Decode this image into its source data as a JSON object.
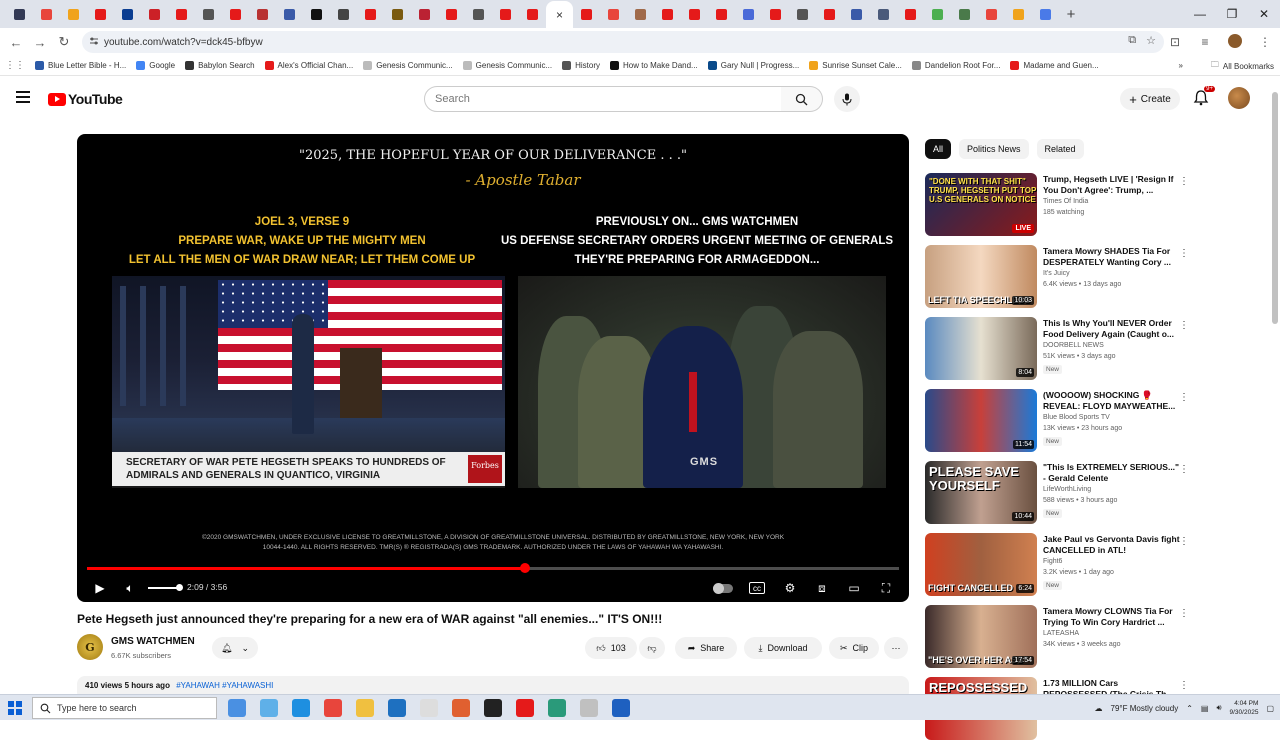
{
  "browser": {
    "tab_colors": [
      "#333a55",
      "#e8453c",
      "#f0a31c",
      "#e51a1a",
      "#0a3d91",
      "#cc2127",
      "#e51a1a",
      "#555555",
      "#e51a1a",
      "#b83232",
      "#3a5aa8",
      "#111111",
      "#444444",
      "#e51a1a",
      "#7a5a10",
      "#bb2233",
      "#e51a1a",
      "#555555",
      "#e51a1a",
      "#e51a1a",
      "#ffffff",
      "#e51a1a",
      "#e8453c",
      "#a06a4a",
      "#e51a1a",
      "#e51a1a",
      "#e51a1a",
      "#4a6ad8",
      "#e51a1a",
      "#555555",
      "#e51a1a",
      "#3a5aa8",
      "#4a5a7a",
      "#e51a1a",
      "#4caf50",
      "#4a7a4a",
      "#e8453c",
      "#f0a31c",
      "#4a7ae8"
    ],
    "active_tab_close": "×",
    "new_tab": "+",
    "url": "youtube.com/watch?v=dck45-bfbyw",
    "bookmarks": [
      {
        "label": "Blue Letter Bible - H...",
        "color": "#2b5aa8"
      },
      {
        "label": "Google",
        "color": "#4285f4"
      },
      {
        "label": "Babylon Search",
        "color": "#333333"
      },
      {
        "label": "Alex's Official Chan...",
        "color": "#e51a1a"
      },
      {
        "label": "Genesis Communic...",
        "color": "#bbbbbb"
      },
      {
        "label": "Genesis Communic...",
        "color": "#bbbbbb"
      },
      {
        "label": "History",
        "color": "#555555"
      },
      {
        "label": "How to Make Dand...",
        "color": "#111111"
      },
      {
        "label": "Gary Null | Progress...",
        "color": "#0a4a8a"
      },
      {
        "label": "Sunrise Sunset Cale...",
        "color": "#f0a31c"
      },
      {
        "label": "Dandelion Root For...",
        "color": "#888888"
      },
      {
        "label": "Madame and Guen...",
        "color": "#e51a1a"
      }
    ],
    "all_bookmarks": "All Bookmarks"
  },
  "header": {
    "logo_text": "YouTube",
    "search_placeholder": "Search",
    "create_label": "Create",
    "notification_count": "9+"
  },
  "player": {
    "quote": "\"2025, THE HOPEFUL YEAR OF OUR DELIVERANCE . . .\"",
    "attribution": "- Apostle Tabar",
    "left_heading": [
      "JOEL 3, VERSE 9",
      "PREPARE WAR, WAKE UP THE MIGHTY MEN",
      "LET ALL THE MEN OF WAR DRAW NEAR; LET THEM COME UP"
    ],
    "right_heading": [
      "PREVIOUSLY ON... GMS WATCHMEN",
      "US DEFENSE SECRETARY ORDERS URGENT MEETING OF GENERALS",
      "THEY'RE PREPARING FOR ARMAGEDDON..."
    ],
    "lower_third": "SECRETARY OF WAR PETE HEGSETH SPEAKS TO HUNDREDS OF ADMIRALS AND GENERALS IN QUANTICO, VIRGINIA",
    "forbes": "Forbes",
    "gms_mark": "GMS",
    "copyright": "©2020 GMSWATCHMEN, UNDER EXCLUSIVE LICENSE TO GREATMILLSTONE, A DIVISION OF GREATMILLSTONE UNIVERSAL. DISTRIBUTED BY GREATMILLSTONE, NEW YORK, NEW YORK 10044-1440. ALL RIGHTS RESERVED. TMR(S) ® REGISTRADA(S) GMS TRADEMARK. AUTHORIZED UNDER THE LAWS OF YAHAWAH WA YAHAWASHI.",
    "progress_fraction": 0.54,
    "time_current": "2:09",
    "time_sep": " / ",
    "time_total": "3:56"
  },
  "video": {
    "title": "Pete Hegseth just announced they're preparing for a new era of WAR against \"all enemies...\" IT'S ON!!!",
    "channel_initial": "G",
    "channel_name": "GMS WATCHMEN",
    "subscribers": "6.67K subscribers",
    "likes": "103",
    "share_label": "Share",
    "download_label": "Download",
    "clip_label": "Clip",
    "views": "410 views",
    "posted": "5 hours ago",
    "tags": "#YAHAWAH #YAHAWASHI"
  },
  "chips": [
    "All",
    "Politics News",
    "Related"
  ],
  "recommendations": [
    {
      "title": "Trump, Hegseth LIVE | 'Resign If You Don't Agree': Trump, ...",
      "channel": "Times Of India",
      "meta": "185 watching",
      "badge": "",
      "duration": "",
      "live": "LIVE",
      "thumb_caption": "\"DONE WITH THAT SHIT\" TRUMP, HEGSETH PUT TOP U.S GENERALS ON NOTICE",
      "thumb_style": "caption",
      "thumb_bg": "linear-gradient(135deg,#1a2a5a,#8a1a1a)"
    },
    {
      "title": "Tamera Mowry SHADES Tia For DESPERATELY Wanting Cory ...",
      "channel": "It's Juicy",
      "meta": "6.4K views • 13 days ago",
      "badge": "",
      "duration": "10:03",
      "live": "",
      "thumb_caption": "LEFT TIA SPEECHLESS",
      "thumb_style": "bottom",
      "thumb_bg": "linear-gradient(90deg,#c7a080,#f4d8c0,#c08a60)"
    },
    {
      "title": "This Is Why You'll NEVER Order Food Delivery Again (Caught o...",
      "channel": "DOORBELL NEWS",
      "meta": "51K views • 3 days ago",
      "badge": "New",
      "duration": "8:04",
      "live": "",
      "thumb_caption": "",
      "thumb_style": "none",
      "thumb_bg": "linear-gradient(90deg,#5a8ac0,#e6e0d0,#7a6a5a)"
    },
    {
      "title": "(WOOOOW) SHOCKING 🥊 REVEAL: FLOYD MAYWEATHE...",
      "channel": "Blue Blood Sports TV",
      "meta": "13K views • 23 hours ago",
      "badge": "New",
      "duration": "11:54",
      "live": "",
      "thumb_caption": "",
      "thumb_style": "none",
      "thumb_bg": "linear-gradient(90deg,#2a4a8a,#c8403a,#1a7ad8)"
    },
    {
      "title": "\"This Is EXTREMELY SERIOUS...\" - Gerald Celente",
      "channel": "LifeWorthLiving",
      "meta": "588 views • 3 hours ago",
      "badge": "New",
      "duration": "10:44",
      "live": "",
      "thumb_caption": "PLEASE SAVE YOURSELF",
      "thumb_style": "big",
      "thumb_bg": "linear-gradient(90deg,#2a2a2a,#c0a090,#6a5040)"
    },
    {
      "title": "Jake Paul vs Gervonta Davis fight CANCELLED in ATL!",
      "channel": "Fight6",
      "meta": "3.2K views • 1 day ago",
      "badge": "New",
      "duration": "6:24",
      "live": "",
      "thumb_caption": "FIGHT CANCELLED",
      "thumb_style": "bottom",
      "thumb_bg": "linear-gradient(90deg,#d04020,#a06040,#d08050)"
    },
    {
      "title": "Tamera Mowry CLOWNS Tia For Trying To Win Cory Hardrict ...",
      "channel": "LATEASHA",
      "meta": "34K views • 3 weeks ago",
      "badge": "",
      "duration": "17:54",
      "live": "",
      "thumb_caption": "\"HE'S OVER HER ASS\"",
      "thumb_style": "bottom",
      "thumb_bg": "linear-gradient(90deg,#3a2a2a,#d8b090,#a0705a)"
    },
    {
      "title": "1.73 MILLION Cars REPOSSESSED (The Crisis Th...",
      "channel": "",
      "meta": "",
      "badge": "",
      "duration": "",
      "live": "",
      "thumb_caption": "REPOSSESSED",
      "thumb_style": "big",
      "thumb_bg": "linear-gradient(90deg,#c81a1a,#e0c0a0)"
    }
  ],
  "taskbar": {
    "search_placeholder": "Type here to search",
    "app_colors": [
      "#4a90e2",
      "#5fb0e8",
      "#1e8fe0",
      "#e8453c",
      "#f0c040",
      "#1e70c0",
      "#dddddd",
      "#e06030",
      "#222222",
      "#e51a1a",
      "#2a9a7a",
      "#c0c0c0",
      "#1e60c0"
    ],
    "weather": "79°F  Mostly cloudy",
    "time": "4:04 PM",
    "date": "9/30/2025"
  }
}
